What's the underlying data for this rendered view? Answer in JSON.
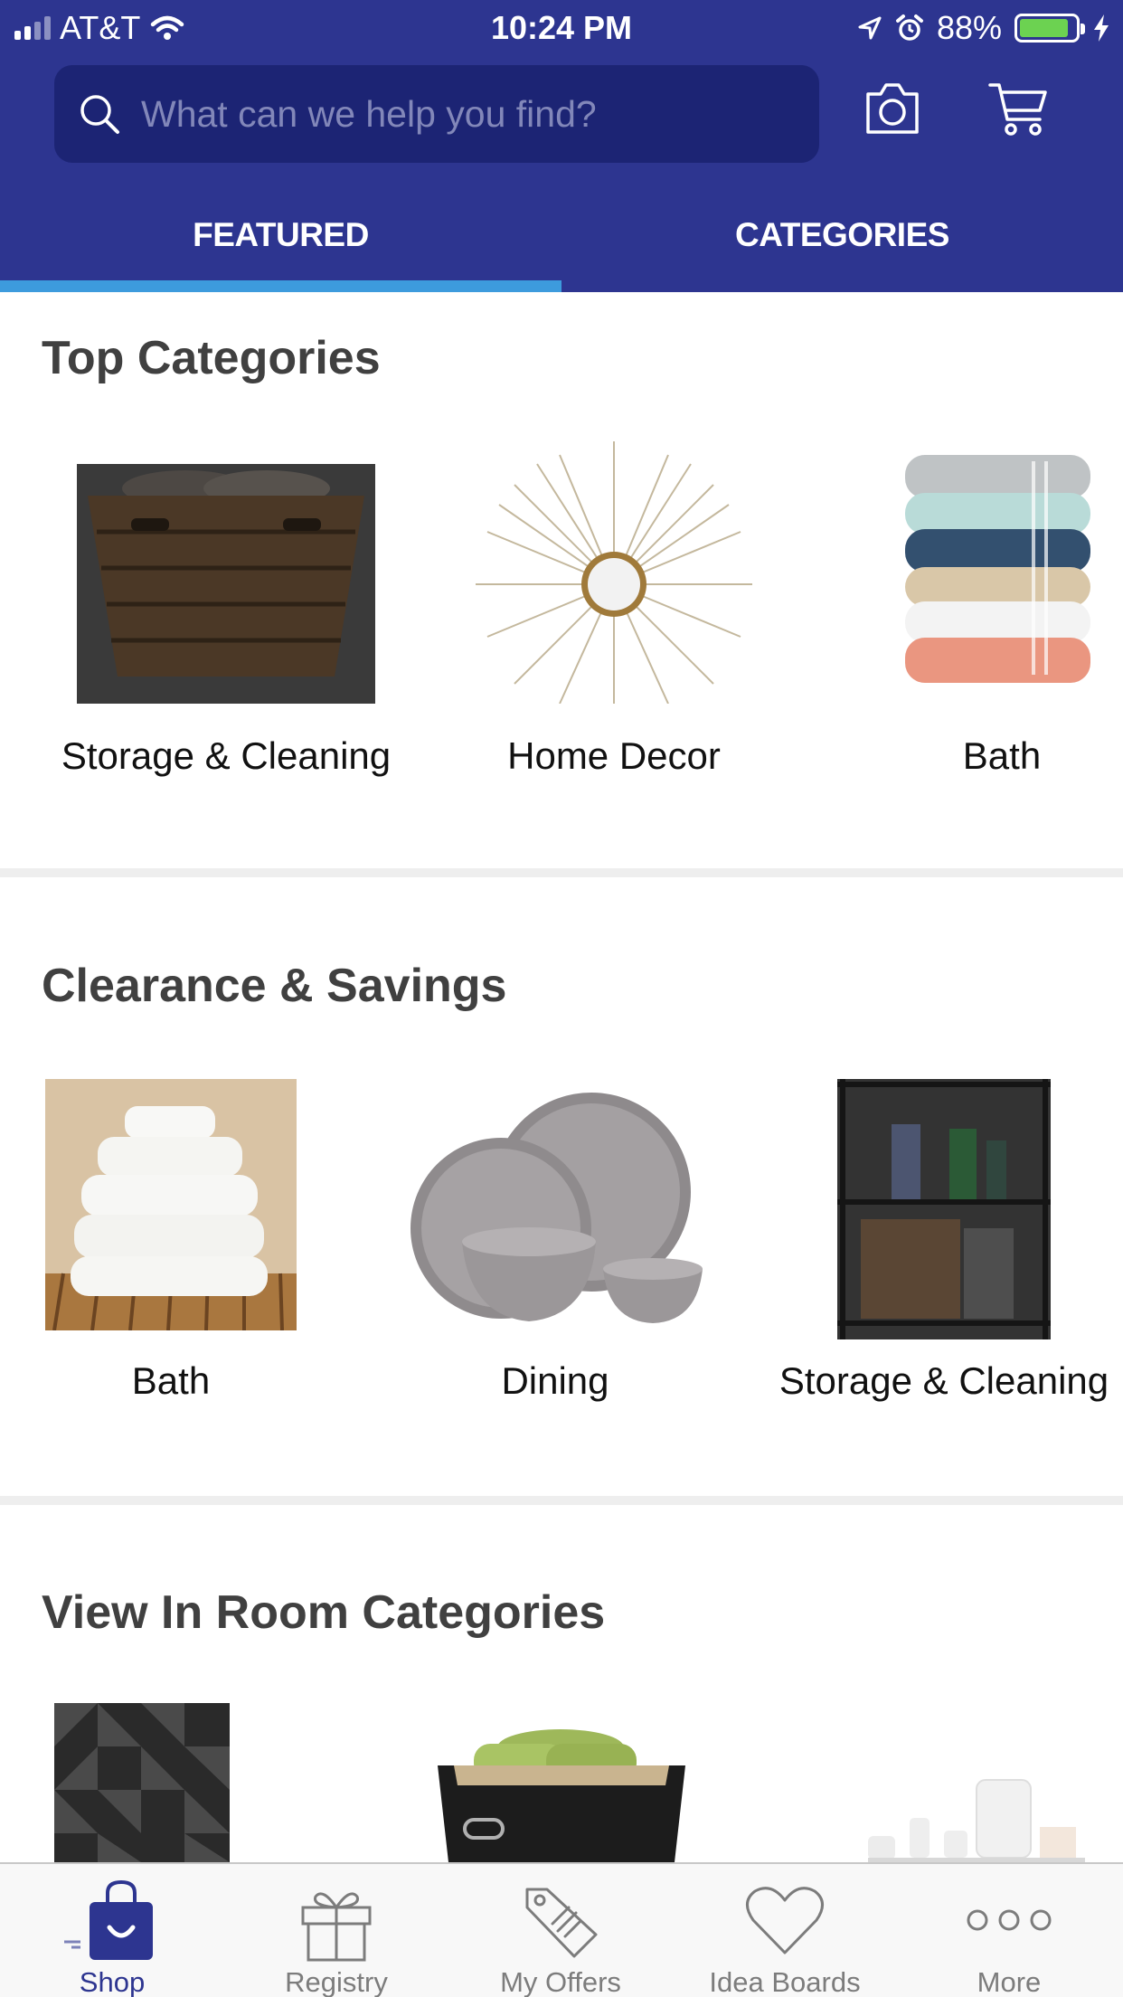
{
  "status_bar": {
    "carrier": "AT&T",
    "time": "10:24 PM",
    "battery": "88%",
    "battery_level": 0.88
  },
  "search": {
    "placeholder": "What can we help you find?"
  },
  "header_icons": [
    "camera-icon",
    "cart-icon"
  ],
  "tabs": [
    {
      "label": "FEATURED",
      "active": true
    },
    {
      "label": "CATEGORIES",
      "active": false
    }
  ],
  "sections": [
    {
      "title": "Top Categories",
      "items": [
        {
          "label": "Storage & Cleaning",
          "image": "wicker-basket-image"
        },
        {
          "label": "Home Decor",
          "image": "sunburst-mirror-image"
        },
        {
          "label": "Bath",
          "image": "towel-stack-image"
        }
      ]
    },
    {
      "title": "Clearance & Savings",
      "items": [
        {
          "label": "Bath",
          "image": "white-towels-image"
        },
        {
          "label": "Dining",
          "image": "dinnerware-image"
        },
        {
          "label": "Storage & Cleaning",
          "image": "wire-shelf-image"
        }
      ]
    },
    {
      "title": "View In Room Categories",
      "items": [
        {
          "image": "geometric-tile-image"
        },
        {
          "image": "storage-bin-image"
        },
        {
          "image": "bath-accessories-image"
        }
      ]
    }
  ],
  "tab_bar": [
    {
      "label": "Shop",
      "icon": "shopping-bag-icon",
      "active": true
    },
    {
      "label": "Registry",
      "icon": "gift-icon",
      "active": false
    },
    {
      "label": "My Offers",
      "icon": "tag-icon",
      "active": false
    },
    {
      "label": "Idea Boards",
      "icon": "heart-icon",
      "active": false
    },
    {
      "label": "More",
      "icon": "more-icon",
      "active": false
    }
  ],
  "colors": {
    "header": "#2d3590",
    "search_field": "#1c2474",
    "tab_indicator": "#3d9bdd",
    "active_tab": "#2d3590"
  }
}
